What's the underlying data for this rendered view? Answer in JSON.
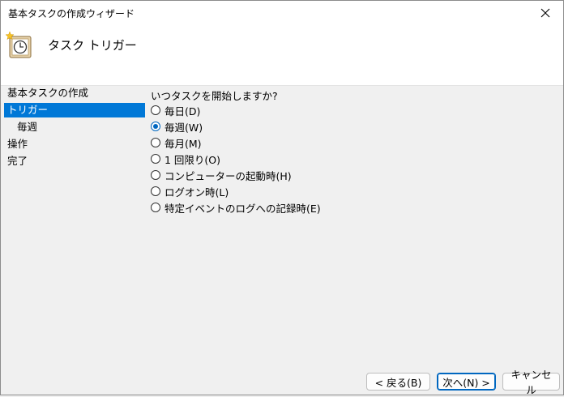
{
  "window": {
    "title": "基本タスクの作成ウィザード"
  },
  "header": {
    "title": "タスク トリガー"
  },
  "sidebar": {
    "items": [
      {
        "label": "基本タスクの作成",
        "selected": false,
        "sub": false
      },
      {
        "label": "トリガー",
        "selected": true,
        "sub": false
      },
      {
        "label": "毎週",
        "selected": false,
        "sub": true
      },
      {
        "label": "操作",
        "selected": false,
        "sub": false
      },
      {
        "label": "完了",
        "selected": false,
        "sub": false
      }
    ]
  },
  "content": {
    "question": "いつタスクを開始しますか?",
    "options": [
      {
        "label": "毎日(D)",
        "checked": false
      },
      {
        "label": "毎週(W)",
        "checked": true
      },
      {
        "label": "毎月(M)",
        "checked": false
      },
      {
        "label": "1 回限り(O)",
        "checked": false
      },
      {
        "label": "コンピューターの起動時(H)",
        "checked": false
      },
      {
        "label": "ログオン時(L)",
        "checked": false
      },
      {
        "label": "特定イベントのログへの記録時(E)",
        "checked": false
      }
    ]
  },
  "buttons": {
    "back": "< 戻る(B)",
    "next": "次へ(N) >",
    "cancel": "キャンセル"
  },
  "icons": {
    "close": "close-icon",
    "header": "scheduled-task-clock-icon"
  },
  "colors": {
    "selection": "#0078d7",
    "radio_accent": "#0067c0"
  }
}
